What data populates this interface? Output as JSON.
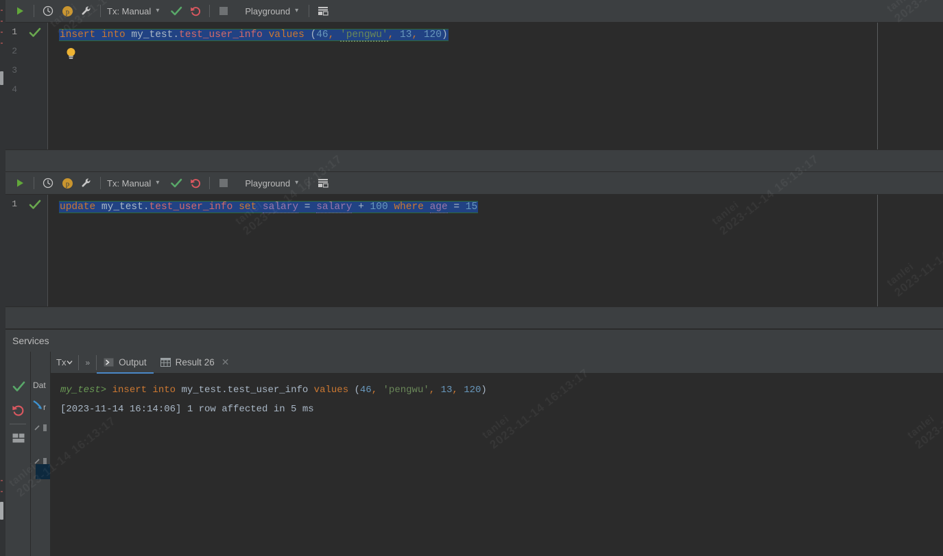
{
  "toolbar": {
    "run_label": "run-icon",
    "history_label": "history-icon",
    "profile_label": "p",
    "wrench_label": "settings-icon",
    "tx_label": "Tx: Manual",
    "commit_label": "commit-icon",
    "rollback_label": "rollback-icon",
    "stop_label": "stop-icon",
    "schema_label": "Playground",
    "grid_label": "grid-icon"
  },
  "editor1": {
    "lines": [
      "1",
      "2",
      "3",
      "4"
    ],
    "code": {
      "kw1": "insert into",
      "space1": " ",
      "schema": "my_test.",
      "table": "test_user_info",
      "kw2": " values ",
      "paren_open": "(",
      "num1": "46",
      "comma1": ", ",
      "string": "'pengwu'",
      "comma2": ", ",
      "num2": "13",
      "comma3": ", ",
      "num3": "120",
      "paren_close": ")"
    },
    "bulb": "lightbulb-icon"
  },
  "editor2": {
    "lines": [
      "1"
    ],
    "code": {
      "kw1": "update ",
      "schema": "my_test.",
      "table": "test_user_info",
      "kw2": " set ",
      "col1": "salary",
      "eq1": " = ",
      "col2": "salary",
      "plus": " + ",
      "num1": "100",
      "kw3": " where ",
      "col3": "age",
      "eq2": " = ",
      "num2": "15"
    }
  },
  "services": {
    "title": "Services",
    "tx_mini": "Tx",
    "chevrons": "»",
    "tabs": [
      {
        "label": "Output",
        "icon": "output-icon",
        "active": true,
        "closable": false
      },
      {
        "label": "Result 26",
        "icon": "table-icon",
        "active": false,
        "closable": true
      }
    ],
    "side_icons": [
      "commit-icon",
      "rollback-icon",
      "layout-icon"
    ],
    "tree_items": [
      "Dat",
      "r"
    ]
  },
  "console": {
    "line1": {
      "prompt": "my_test>",
      "kw1": " insert into ",
      "plain1": "my_test.test_user_info",
      "kw2": " values ",
      "paren_open": "(",
      "num1": "46",
      "comma1": ", ",
      "string": "'pengwu'",
      "comma2": ", ",
      "num2": "13",
      "comma3": ", ",
      "num3": "120",
      "paren_close": ")"
    },
    "line2": "[2023-11-14 16:14:06] 1 row affected in 5 ms"
  },
  "watermark": {
    "line1": "tanlei",
    "line2": "2023-11-14 16:13:17"
  },
  "colors": {
    "keyword": "#cc7832",
    "table": "#d26a6a",
    "number": "#6897bb",
    "string": "#6a8759",
    "column": "#9876aa",
    "selection": "#214283",
    "accent": "#4a88c7",
    "run_green": "#62a83a",
    "rollback_red": "#db5860"
  }
}
